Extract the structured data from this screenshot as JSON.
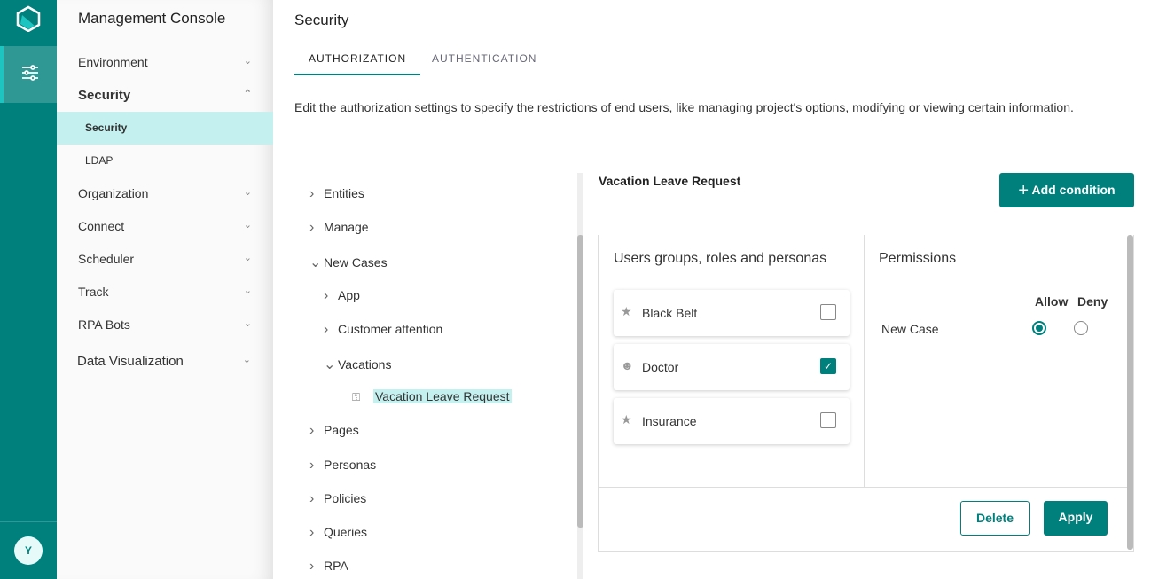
{
  "app": {
    "title": "Management Console",
    "avatar": "Y"
  },
  "nav": [
    {
      "label": "Environment",
      "chevron": "chevron-down"
    },
    {
      "label": "Security",
      "chevron": "chevron-up",
      "bold": true
    },
    {
      "label": "Organization",
      "chevron": "chevron-down"
    },
    {
      "label": "Connect",
      "chevron": "chevron-down"
    },
    {
      "label": "Scheduler",
      "chevron": "chevron-down"
    },
    {
      "label": "Track",
      "chevron": "chevron-down"
    },
    {
      "label": "RPA Bots",
      "chevron": "chevron-down"
    },
    {
      "label": "Data Visualization",
      "chevron": "chevron-down"
    }
  ],
  "subnav": [
    {
      "label": "Security",
      "selected": true
    },
    {
      "label": "LDAP"
    }
  ],
  "page": {
    "title": "Security",
    "tabs": [
      {
        "label": "AUTHORIZATION",
        "active": true
      },
      {
        "label": "AUTHENTICATION"
      }
    ],
    "description": "Edit the authorization settings to specify the restrictions of end users, like managing project's options, modifying or viewing certain information."
  },
  "tree": [
    {
      "label": "Entities",
      "state": "collapsed"
    },
    {
      "label": "Manage",
      "state": "collapsed"
    },
    {
      "label": "New Cases",
      "state": "expanded"
    },
    {
      "label": "App",
      "state": "collapsed"
    },
    {
      "label": "Customer attention",
      "state": "collapsed"
    },
    {
      "label": "Vacations",
      "state": "expanded"
    },
    {
      "label": "Vacation Leave Request",
      "state": "leaf",
      "selected": true
    },
    {
      "label": "Pages",
      "state": "collapsed"
    },
    {
      "label": "Personas",
      "state": "collapsed"
    },
    {
      "label": "Policies",
      "state": "collapsed"
    },
    {
      "label": "Queries",
      "state": "collapsed"
    },
    {
      "label": "RPA",
      "state": "collapsed"
    }
  ],
  "panel": {
    "title": "Vacation Leave Request",
    "add_condition": "Add condition",
    "groups_header": "Users groups, roles and personas",
    "groups": [
      {
        "label": "Black Belt",
        "icon": "star",
        "checked": false
      },
      {
        "label": "Doctor",
        "icon": "person",
        "checked": true
      },
      {
        "label": "Insurance",
        "icon": "star",
        "checked": false
      }
    ],
    "permissions_header": "Permissions",
    "allow": "Allow",
    "deny": "Deny",
    "permission": {
      "label": "New Case",
      "value": "Allow"
    },
    "delete": "Delete",
    "apply": "Apply"
  },
  "colors": {
    "accent": "#00807c",
    "selected": "#c4f1ef"
  }
}
